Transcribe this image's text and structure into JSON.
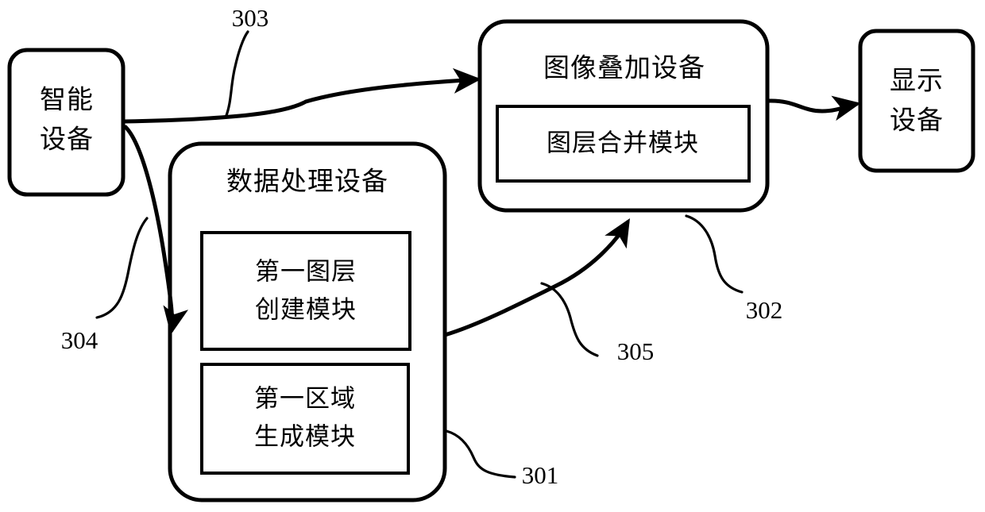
{
  "figure": {
    "type": "patent-block-diagram",
    "background_color": "#ffffff",
    "line_color": "#000000"
  },
  "nodes": {
    "smart_device": {
      "label": "智能设备",
      "line1": "智能",
      "line2": "设备"
    },
    "data_processing_device": {
      "label": "数据处理设备",
      "modules": [
        {
          "line1": "第一图层",
          "line2": "创建模块"
        },
        {
          "line1": "第一区域",
          "line2": "生成模块"
        }
      ]
    },
    "image_overlay_device": {
      "label": "图像叠加设备",
      "modules": [
        {
          "label": "图层合并模块"
        }
      ]
    },
    "display_device": {
      "label": "显示设备",
      "line1": "显示",
      "line2": "设备"
    }
  },
  "reference_numerals": {
    "n301": "301",
    "n302": "302",
    "n303": "303",
    "n304": "304",
    "n305": "305"
  }
}
